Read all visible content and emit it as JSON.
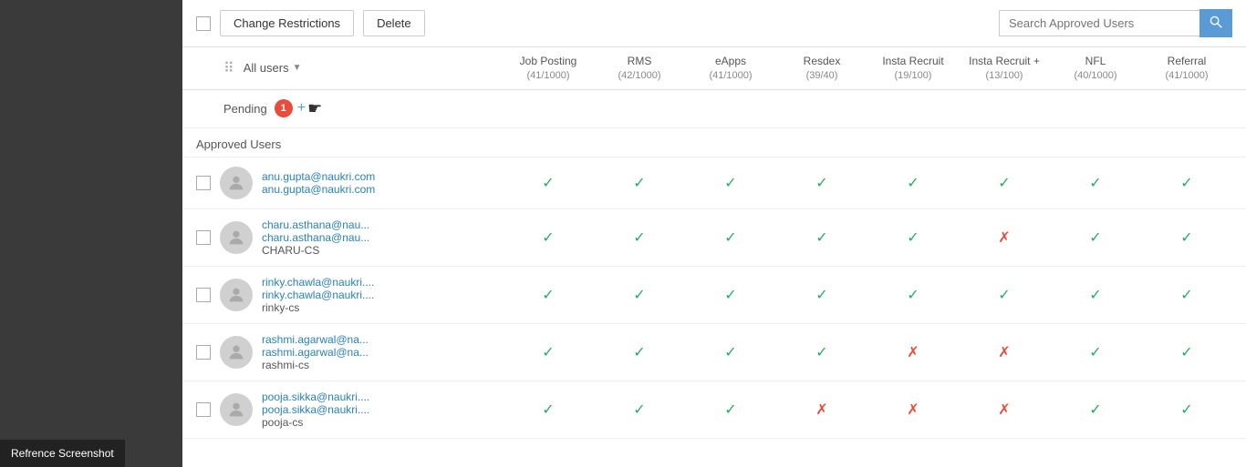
{
  "toolbar": {
    "change_restrictions_label": "Change Restrictions",
    "delete_label": "Delete",
    "search_placeholder": "Search Approved Users",
    "search_icon": "🔍"
  },
  "filter": {
    "all_users_label": "All users",
    "columns": [
      {
        "name": "Job Posting",
        "count": "(41/1000)"
      },
      {
        "name": "RMS",
        "count": "(42/1000)"
      },
      {
        "name": "eApps",
        "count": "(41/1000)"
      },
      {
        "name": "Resdex",
        "count": "(39/40)"
      },
      {
        "name": "Insta Recruit",
        "count": "(19/100)"
      },
      {
        "name": "Insta Recruit +",
        "count": "(13/100)"
      },
      {
        "name": "NFL",
        "count": "(40/1000)"
      },
      {
        "name": "Referral",
        "count": "(41/1000)"
      }
    ]
  },
  "pending": {
    "label": "Pending",
    "count": "1"
  },
  "approved_header": "Approved Users",
  "users": [
    {
      "email1": "anu.gupta@naukri.com",
      "email2": "anu.gupta@naukri.com",
      "company": "",
      "checks": [
        "yes",
        "yes",
        "yes",
        "yes",
        "yes",
        "yes",
        "yes",
        "yes"
      ]
    },
    {
      "email1": "charu.asthana@nau...",
      "email2": "charu.asthana@nau...",
      "company": "CHARU-CS",
      "checks": [
        "yes",
        "yes",
        "yes",
        "yes",
        "yes",
        "no",
        "yes",
        "yes"
      ]
    },
    {
      "email1": "rinky.chawla@naukri....",
      "email2": "rinky.chawla@naukri....",
      "company": "rinky-cs",
      "checks": [
        "yes",
        "yes",
        "yes",
        "yes",
        "yes",
        "yes",
        "yes",
        "yes"
      ]
    },
    {
      "email1": "rashmi.agarwal@na...",
      "email2": "rashmi.agarwal@na...",
      "company": "rashmi-cs",
      "checks": [
        "yes",
        "yes",
        "yes",
        "yes",
        "no",
        "no",
        "yes",
        "yes"
      ]
    },
    {
      "email1": "pooja.sikka@naukri....",
      "email2": "pooja.sikka@naukri....",
      "company": "pooja-cs",
      "checks": [
        "yes",
        "yes",
        "yes",
        "no",
        "no",
        "no",
        "yes",
        "yes"
      ]
    }
  ],
  "ref_label": "Refrence Screenshot"
}
